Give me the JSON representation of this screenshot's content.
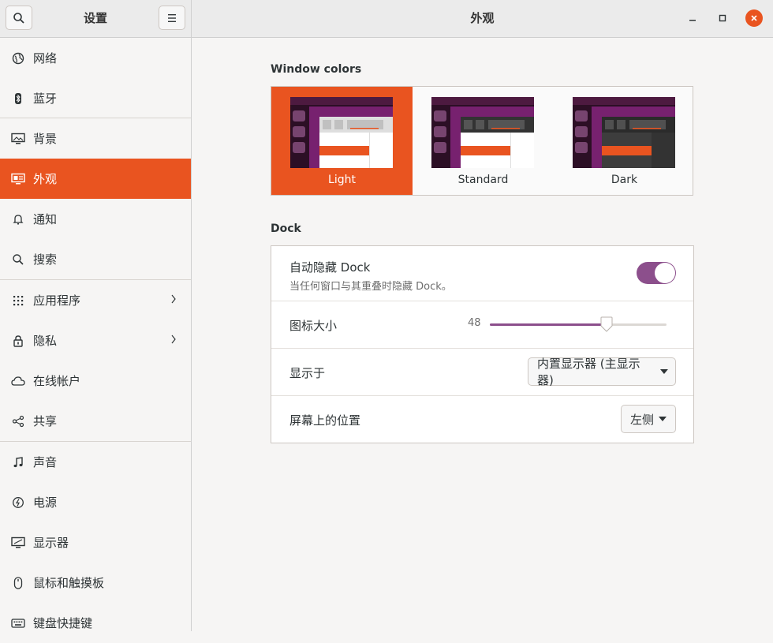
{
  "sidebar": {
    "title": "设置",
    "items": [
      {
        "label": "网络",
        "icon": "globe-icon"
      },
      {
        "label": "蓝牙",
        "icon": "bluetooth-icon"
      },
      {
        "label": "背景",
        "icon": "monitor-background-icon"
      },
      {
        "label": "外观",
        "icon": "appearance-icon",
        "active": true
      },
      {
        "label": "通知",
        "icon": "bell-icon"
      },
      {
        "label": "搜索",
        "icon": "search-icon"
      },
      {
        "label": "应用程序",
        "icon": "apps-grid-icon",
        "chevron": true
      },
      {
        "label": "隐私",
        "icon": "lock-icon",
        "chevron": true
      },
      {
        "label": "在线帐户",
        "icon": "cloud-icon"
      },
      {
        "label": "共享",
        "icon": "share-icon"
      },
      {
        "label": "声音",
        "icon": "music-note-icon"
      },
      {
        "label": "电源",
        "icon": "power-icon"
      },
      {
        "label": "显示器",
        "icon": "display-icon"
      },
      {
        "label": "鼠标和触摸板",
        "icon": "mouse-icon"
      },
      {
        "label": "键盘快捷键",
        "icon": "keyboard-icon"
      }
    ]
  },
  "main": {
    "title": "外观",
    "window_colors": {
      "heading": "Window colors",
      "themes": [
        {
          "label": "Light",
          "selected": true
        },
        {
          "label": "Standard",
          "selected": false
        },
        {
          "label": "Dark",
          "selected": false
        }
      ]
    },
    "dock": {
      "heading": "Dock",
      "autohide_label": "自动隐藏 Dock",
      "autohide_desc": "当任何窗口与其重叠时隐藏 Dock。",
      "autohide_on": true,
      "icon_size_label": "图标大小",
      "icon_size_value": "48",
      "icon_size_fraction": 0.66,
      "show_on_label": "显示于",
      "show_on_value": "内置显示器 (主显示器)",
      "position_label": "屏幕上的位置",
      "position_value": "左侧"
    }
  },
  "colors": {
    "accent": "#e95420",
    "toggle": "#8c4f8c",
    "aubergine": "#5e2750"
  }
}
